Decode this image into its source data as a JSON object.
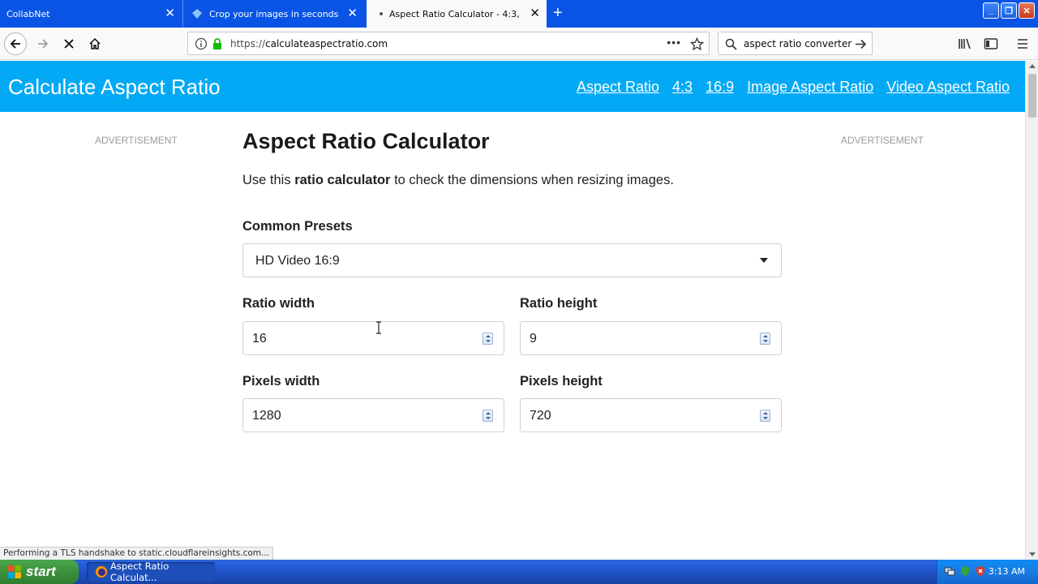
{
  "browser": {
    "tabs": [
      {
        "title": "CollabNet",
        "active": false
      },
      {
        "title": "Crop your images in seconds for f",
        "active": false
      },
      {
        "title": "Aspect Ratio Calculator - 4:3, 16:",
        "active": true
      }
    ],
    "url_scheme": "https://",
    "url_host": "calculateaspectratio.com",
    "search_text": "aspect ratio converter",
    "status": "Performing a TLS handshake to static.cloudflareinsights.com..."
  },
  "site": {
    "title": "Calculate Aspect Ratio",
    "nav": [
      "Aspect Ratio",
      "4:3",
      "16:9",
      "Image Aspect Ratio",
      "Video Aspect Ratio"
    ],
    "ad_left": "ADVERTISEMENT",
    "ad_right": "ADVERTISEMENT",
    "header_color": "#03a9f4"
  },
  "calculator": {
    "title": "Aspect Ratio Calculator",
    "intro_before": "Use this ",
    "intro_bold": "ratio calculator",
    "intro_after": " to check the dimensions when resizing images.",
    "presets_label": "Common Presets",
    "preset_value": "HD Video 16:9",
    "ratio_width_label": "Ratio width",
    "ratio_width": "16",
    "ratio_height_label": "Ratio height",
    "ratio_height": "9",
    "pixels_width_label": "Pixels width",
    "pixels_width": "1280",
    "pixels_height_label": "Pixels height",
    "pixels_height": "720"
  },
  "taskbar": {
    "start": "start",
    "task": "Aspect Ratio Calculat...",
    "clock": "3:13 AM"
  }
}
